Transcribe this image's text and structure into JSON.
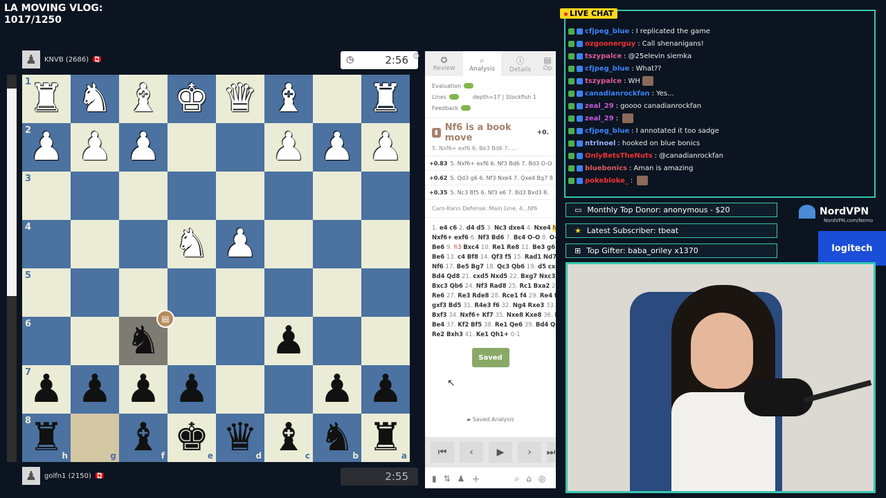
{
  "overlay": {
    "title_line1": "LA MOVING VLOG:",
    "title_line2": "1017/1250"
  },
  "top_player": {
    "name": "KNVB (2686)",
    "flag": "🇨🇦",
    "clock": "2:56"
  },
  "bottom_player": {
    "name": "golfn1 (2150)",
    "flag": "🇨🇦",
    "clock": "2:55"
  },
  "board": {
    "ranks": [
      "1",
      "2",
      "3",
      "4",
      "5",
      "6",
      "7",
      "8"
    ],
    "files": [
      "h",
      "g",
      "f",
      "e",
      "d",
      "c",
      "b",
      "a"
    ],
    "rows": [
      [
        "♜",
        "♞",
        "♝",
        "♚",
        "♛",
        "♝",
        "",
        "♜"
      ],
      [
        "♟",
        "♟",
        "♟",
        "",
        "",
        "♟",
        "♟",
        "♟"
      ],
      [
        "",
        "",
        "",
        "",
        "",
        "",
        "",
        ""
      ],
      [
        "",
        "",
        "",
        "♞",
        "♟",
        "",
        "",
        ""
      ],
      [
        "",
        "",
        "",
        "",
        "",
        "",
        "",
        ""
      ],
      [
        "",
        "",
        "♞",
        "",
        "",
        "♟",
        "",
        ""
      ],
      [
        "♟",
        "♟",
        "♟",
        "♟",
        "",
        "",
        "♟",
        "♟"
      ],
      [
        "♜",
        "",
        "♝",
        "♚",
        "♛",
        "♝",
        "♞",
        "♜"
      ]
    ],
    "colors": [
      [
        "w",
        "w",
        "w",
        "w",
        "w",
        "w",
        "",
        "w"
      ],
      [
        "w",
        "w",
        "w",
        "",
        "",
        "w",
        "w",
        "w"
      ],
      [
        "",
        "",
        "",
        "",
        "",
        "",
        "",
        ""
      ],
      [
        "",
        "",
        "",
        "w",
        "w",
        "",
        "",
        ""
      ],
      [
        "",
        "",
        "",
        "",
        "",
        "",
        "",
        ""
      ],
      [
        "",
        "",
        "b",
        "",
        "",
        "b",
        "",
        ""
      ],
      [
        "b",
        "b",
        "b",
        "b",
        "",
        "",
        "b",
        "b"
      ],
      [
        "b",
        "",
        "b",
        "b",
        "b",
        "b",
        "b",
        "b"
      ]
    ],
    "book_badge_icon": "book-icon"
  },
  "panel": {
    "tabs": [
      {
        "label": "Review",
        "icon": "star-icon"
      },
      {
        "label": "Analysis",
        "icon": "magnifier-icon"
      },
      {
        "label": "Details",
        "icon": "info-icon"
      },
      {
        "label": "Op",
        "icon": "book-icon"
      }
    ],
    "settings": {
      "evaluation": "Evaluation",
      "lines": "Lines",
      "feedback": "Feedback",
      "depth": "depth=17 | Stockfish 1"
    },
    "book_move": {
      "title": "Nf6 is a book move",
      "eval": "+0.",
      "sub": "5. Nxf6+ exf6 6. Be3 Bd6 7. ..."
    },
    "lines": [
      {
        "score": "+0.83",
        "moves": "5. Nxf6+ exf6 6. Nf3 Bd6 7. Bd3 O-O"
      },
      {
        "score": "+0.62",
        "moves": "5. Qd3 g6 6. Nf3 Nxe4 7. Qxe4 Bg7 8"
      },
      {
        "score": "+0.35",
        "moves": "5. Nc3 Bf5 6. Nf3 e6 7. Bd3 Bxd3 8."
      }
    ],
    "opening": "Caro-Kann Defense: Main Line, 4...Nf6",
    "pgn": [
      [
        [
          "1.",
          "num"
        ],
        [
          "e4",
          "mv"
        ],
        [
          "c6",
          "mv"
        ],
        [
          "2.",
          "num"
        ],
        [
          "d4",
          "mv"
        ],
        [
          "d5",
          "mv"
        ],
        [
          "3.",
          "num"
        ],
        [
          "Nc3",
          "mv"
        ],
        [
          "dxe4",
          "mv"
        ],
        [
          "4.",
          "num"
        ],
        [
          "Nxe4",
          "mv"
        ],
        [
          "Nf6",
          "cur"
        ]
      ],
      [
        [
          "Nxf6+",
          "mv"
        ],
        [
          "exf6",
          "mv"
        ],
        [
          "6.",
          "num"
        ],
        [
          "Nf3",
          "mv"
        ],
        [
          "Bd6",
          "mv"
        ],
        [
          "7.",
          "num"
        ],
        [
          "Bc4",
          "mv"
        ],
        [
          "O-O",
          "mv"
        ],
        [
          "8.",
          "num"
        ],
        [
          "O-O",
          "mv"
        ]
      ],
      [
        [
          "Be6",
          "mv"
        ],
        [
          "9.",
          "num"
        ],
        [
          "h3",
          "red"
        ],
        [
          "Bxc4",
          "mv"
        ],
        [
          "10.",
          "num"
        ],
        [
          "Re1",
          "mv"
        ],
        [
          "Re8",
          "mv"
        ],
        [
          "11.",
          "num"
        ],
        [
          "Be3",
          "mv"
        ],
        [
          "g6",
          "mv"
        ],
        [
          "12.",
          "num"
        ]
      ],
      [
        [
          "Be6",
          "mv"
        ],
        [
          "13.",
          "num"
        ],
        [
          "c4",
          "mv"
        ],
        [
          "Bf8",
          "mv"
        ],
        [
          "14.",
          "num"
        ],
        [
          "Qf3",
          "mv"
        ],
        [
          "f5",
          "mv"
        ],
        [
          "15.",
          "num"
        ],
        [
          "Rad1",
          "mv"
        ],
        [
          "Nd7",
          "mv"
        ],
        [
          "16.",
          "num"
        ]
      ],
      [
        [
          "Nf6",
          "mv"
        ],
        [
          "17.",
          "num"
        ],
        [
          "Be5",
          "mv"
        ],
        [
          "Bg7",
          "mv"
        ],
        [
          "18.",
          "num"
        ],
        [
          "Qc3",
          "mv"
        ],
        [
          "Qb6",
          "mv"
        ],
        [
          "19.",
          "num"
        ],
        [
          "d5",
          "mv"
        ],
        [
          "cxd5",
          "mv"
        ],
        [
          "20.",
          "num"
        ]
      ],
      [
        [
          "Bd4",
          "mv"
        ],
        [
          "Qd8",
          "mv"
        ],
        [
          "21.",
          "num"
        ],
        [
          "cxd5",
          "mv"
        ],
        [
          "Nxd5",
          "mv"
        ],
        [
          "22.",
          "num"
        ],
        [
          "Bxg7",
          "mv"
        ],
        [
          "Nxc3",
          "mv"
        ],
        [
          "23.",
          "num"
        ]
      ],
      [
        [
          "Bxc3",
          "mv"
        ],
        [
          "Qb6",
          "mv"
        ],
        [
          "24.",
          "num"
        ],
        [
          "Nf3",
          "mv"
        ],
        [
          "Rad8",
          "mv"
        ],
        [
          "25.",
          "num"
        ],
        [
          "Rc1",
          "mv"
        ],
        [
          "Bxa2",
          "mv"
        ],
        [
          "26.",
          "num"
        ]
      ],
      [
        [
          "Re6",
          "mv"
        ],
        [
          "27.",
          "num"
        ],
        [
          "Re3",
          "mv"
        ],
        [
          "Rde8",
          "mv"
        ],
        [
          "28.",
          "num"
        ],
        [
          "Rce1",
          "mv"
        ],
        [
          "f4",
          "mv"
        ],
        [
          "29.",
          "num"
        ],
        [
          "Re4",
          "mv"
        ],
        [
          "f3",
          "mv"
        ],
        [
          "30.",
          "num"
        ]
      ],
      [
        [
          "gxf3",
          "mv"
        ],
        [
          "Bd5",
          "mv"
        ],
        [
          "31.",
          "num"
        ],
        [
          "R4e3",
          "mv"
        ],
        [
          "f6",
          "mv"
        ],
        [
          "32.",
          "num"
        ],
        [
          "Ng4",
          "mv"
        ],
        [
          "Rxe3",
          "mv"
        ],
        [
          "33.",
          "num"
        ],
        [
          "fxe",
          "mv"
        ]
      ],
      [
        [
          "Bxf3",
          "mv"
        ],
        [
          "34.",
          "num"
        ],
        [
          "Nxf6+",
          "mv"
        ],
        [
          "Kf7",
          "mv"
        ],
        [
          "35.",
          "num"
        ],
        [
          "Nxe8",
          "mv"
        ],
        [
          "Kxe8",
          "mv"
        ],
        [
          "36.",
          "num"
        ],
        [
          "Rf1",
          "mv"
        ]
      ],
      [
        [
          "Be4",
          "mv"
        ],
        [
          "37.",
          "num"
        ],
        [
          "Kf2",
          "mv"
        ],
        [
          "Bf5",
          "mv"
        ],
        [
          "38.",
          "num"
        ],
        [
          "Re1",
          "mv"
        ],
        [
          "Qe6",
          "mv"
        ],
        [
          "39.",
          "num"
        ],
        [
          "Bd4",
          "mv"
        ],
        [
          "Qe4",
          "mv"
        ]
      ],
      [
        [
          "Re2",
          "mv"
        ],
        [
          "Bxh3",
          "mv"
        ],
        [
          "41.",
          "num"
        ],
        [
          "Ke1",
          "mv"
        ],
        [
          "Qh1+",
          "mv"
        ],
        [
          "0-1",
          "num"
        ]
      ]
    ],
    "saved_button": "Saved",
    "saved_analysis": "Saved Analysis",
    "nav": [
      "⏮",
      "‹",
      "▶",
      "›",
      "⏭"
    ],
    "bottom_icons": [
      "bar-chart-icon",
      "flip-icon",
      "piece-icon",
      "plus-icon",
      "zoom-icon",
      "bank-icon",
      "settings-icon"
    ]
  },
  "chat": {
    "badge": "LIVE CHAT",
    "lines": [
      {
        "user": "cfjpeg_blue",
        "color": "#3b82f6",
        "msg": "I replicated the game"
      },
      {
        "user": "ozgoonerguy",
        "color": "#e33",
        "msg": "Call shenanigans!"
      },
      {
        "user": "tszypalce",
        "color": "#e05a9c",
        "msg": "@25elevin siemka"
      },
      {
        "user": "cfjpeg_blue",
        "color": "#3b82f6",
        "msg": "What??"
      },
      {
        "user": "tszypalce",
        "color": "#e05a9c",
        "msg": "WH"
      },
      {
        "user": "canadianrockfan",
        "color": "#3b82f6",
        "msg": "Yes..."
      },
      {
        "user": "zeal_29",
        "color": "#c05ad8",
        "msg": "goooo canadianrockfan"
      },
      {
        "user": "zeal_29",
        "color": "#c05ad8",
        "msg": ""
      },
      {
        "user": "cfjpeg_blue",
        "color": "#3b82f6",
        "msg": "I annotated it too sadge"
      },
      {
        "user": "ntrlnoel",
        "color": "#9bb0ff",
        "msg": "hooked on blue bonics"
      },
      {
        "user": "OnlyBetsTheNuts",
        "color": "#e33",
        "msg": "@canadianrockfan"
      },
      {
        "user": "bluebonics",
        "color": "#e05a5a",
        "msg": "Aman is amazing"
      },
      {
        "user": "pokebloke_",
        "color": "#e33",
        "msg": ""
      }
    ]
  },
  "info_boxes": [
    {
      "icon": "monitor-icon",
      "text": "Monthly Top Donor: anonymous - $20"
    },
    {
      "icon": "star-icon",
      "text": "Latest Subscriber: tbeat"
    },
    {
      "icon": "gift-icon",
      "text": "Top Gifter: baba_oriley x1370"
    }
  ],
  "sponsors": {
    "nord": "NordVPN",
    "nord_sub": "NordVPN.com/Nemo",
    "logitech": "logitech"
  },
  "colors": {
    "accent": "#39c6b1",
    "board_light": "#eaecd6",
    "board_dark": "#4b72a0",
    "live": "#f9d71c"
  }
}
